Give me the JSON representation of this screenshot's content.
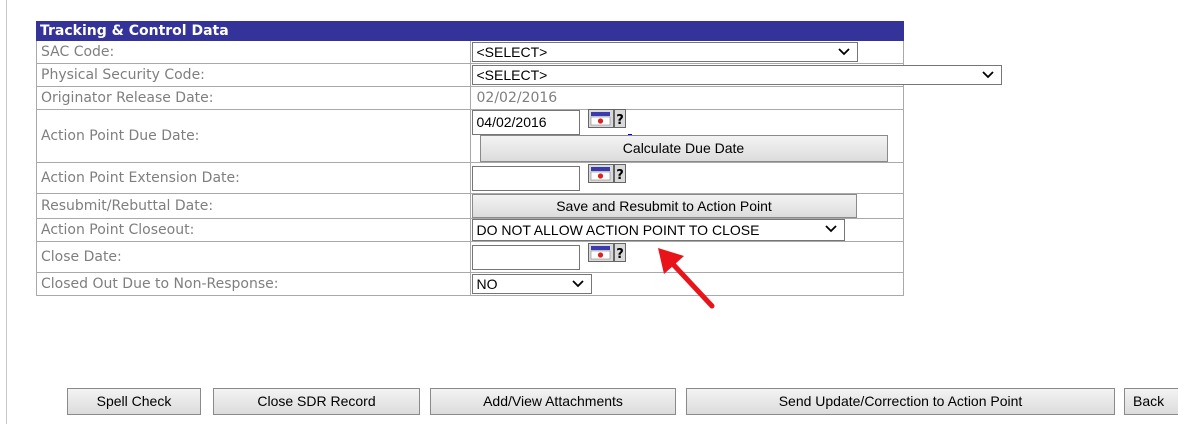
{
  "panel": {
    "header": "Tracking & Control Data",
    "rows": {
      "sac_code": {
        "label": "SAC Code:",
        "value": "<SELECT>"
      },
      "physical_security_code": {
        "label": "Physical Security Code:",
        "value": "<SELECT>"
      },
      "originator_release_date": {
        "label": "Originator Release Date:",
        "value": "02/02/2016"
      },
      "action_point_due_date": {
        "label": "Action Point Due Date:",
        "value": "04/02/2016",
        "button": "Calculate Due Date"
      },
      "action_point_extension_date": {
        "label": "Action Point Extension Date:",
        "value": ""
      },
      "resubmit_rebuttal_date": {
        "label": "Resubmit/Rebuttal Date:",
        "button": "Save and Resubmit to Action Point"
      },
      "action_point_closeout": {
        "label": "Action Point Closeout:",
        "value": "DO NOT ALLOW ACTION POINT TO CLOSE"
      },
      "close_date": {
        "label": "Close Date:",
        "value": ""
      },
      "closed_out_non_response": {
        "label": "Closed Out Due to Non-Response:",
        "value": "NO"
      }
    }
  },
  "footer": {
    "spell_check": "Spell Check",
    "close_sdr_record": "Close SDR Record",
    "add_view_attachments": "Add/View Attachments",
    "send_update": "Send Update/Correction to Action Point",
    "back": "Back"
  },
  "icons": {
    "calendar": "calendar-help-icon",
    "chevron": "chevron-down-icon",
    "annotation": "red-arrow-icon"
  },
  "colors": {
    "header_bg": "#333399",
    "annotation": "#e8141a"
  }
}
